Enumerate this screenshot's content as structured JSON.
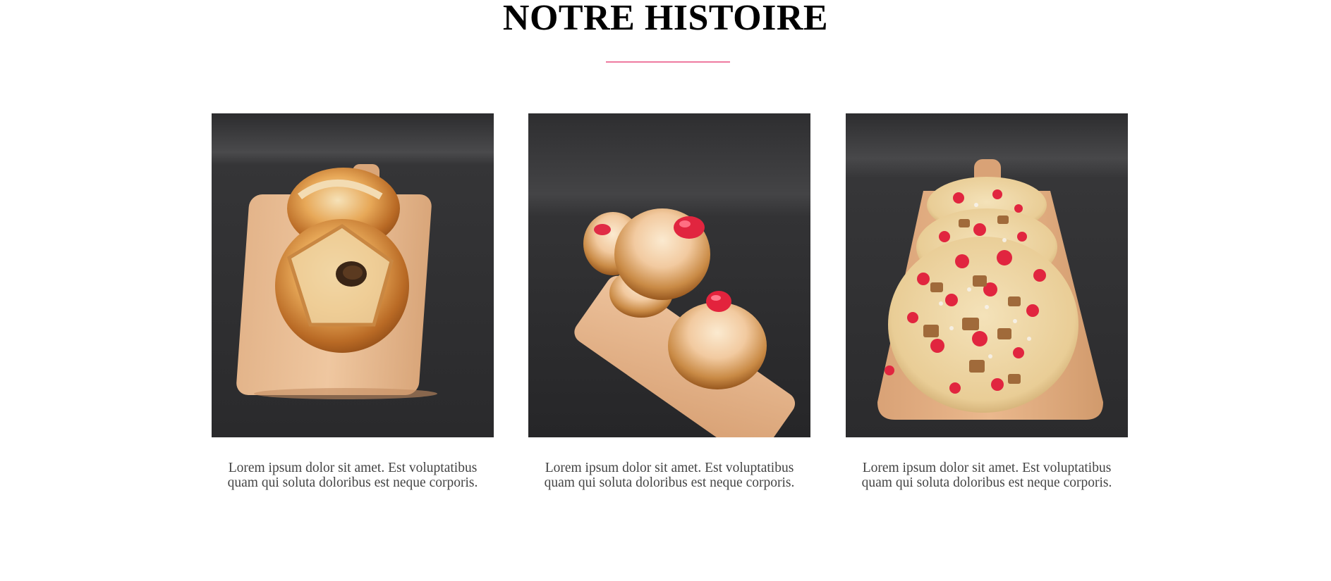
{
  "section": {
    "title": "NOTRE HISTOIRE",
    "accent_color": "#ee7aa0"
  },
  "cards": [
    {
      "image_icon": "brioche-ring-photo",
      "caption": "Lorem ipsum dolor sit amet. Est voluptatibus quam qui soluta doloribus est neque corporis."
    },
    {
      "image_icon": "praline-brioche-buns-photo",
      "caption": "Lorem ipsum dolor sit amet. Est voluptatibus quam qui soluta doloribus est neque corporis."
    },
    {
      "image_icon": "praline-flatbread-photo",
      "caption": "Lorem ipsum dolor sit amet. Est voluptatibus quam qui soluta doloribus est neque corporis."
    }
  ]
}
